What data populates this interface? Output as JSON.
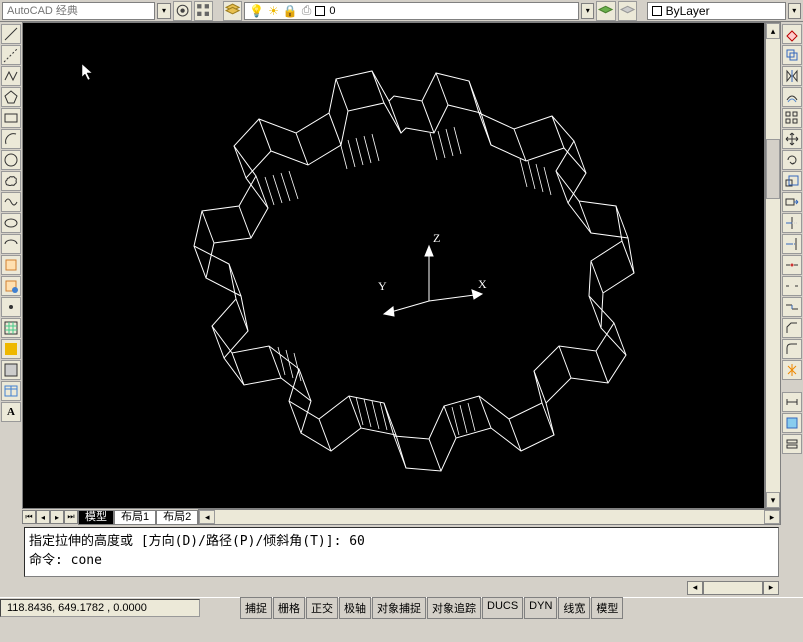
{
  "top": {
    "workspace_placeholder": "AutoCAD 经典",
    "layer_text": "0",
    "bylayer_text": "ByLayer"
  },
  "ucs": {
    "x": "X",
    "y": "Y",
    "z": "Z"
  },
  "tabs": {
    "model": "模型",
    "layout1": "布局1",
    "layout2": "布局2"
  },
  "command": {
    "line1": "指定拉伸的高度或 [方向(D)/路径(P)/倾斜角(T)]: 60",
    "line2": "命令: cone"
  },
  "status": {
    "coords": "118.8436, 649.1782 , 0.0000",
    "toggles": [
      "捕捉",
      "栅格",
      "正交",
      "极轴",
      "对象捕捉",
      "对象追踪",
      "DUCS",
      "DYN",
      "线宽",
      "模型"
    ]
  }
}
